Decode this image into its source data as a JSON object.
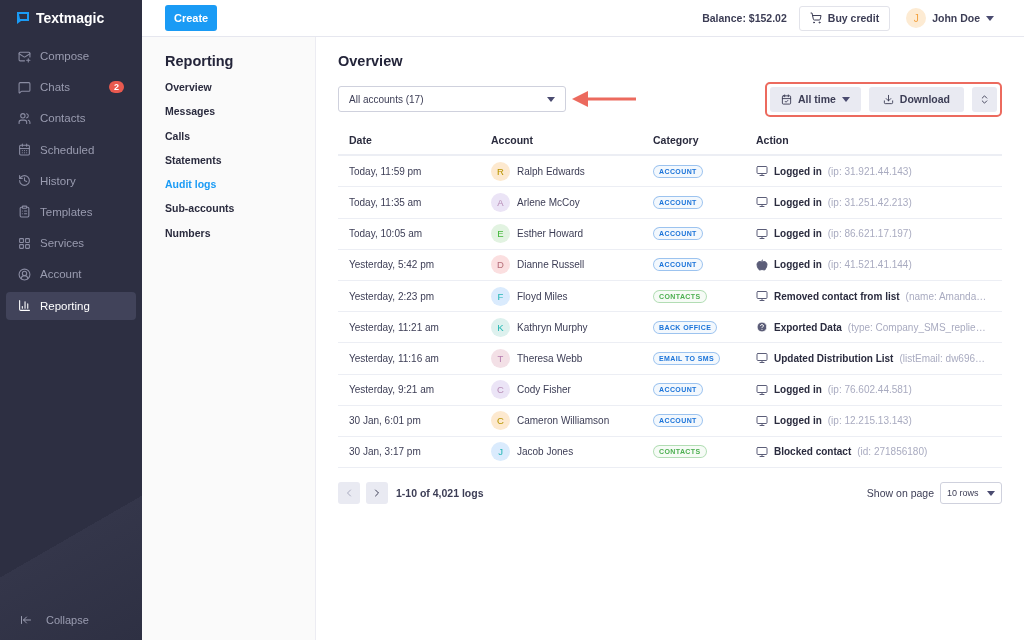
{
  "brand": "Textmagic",
  "sidebar": {
    "items": [
      {
        "label": "Compose",
        "selected": false
      },
      {
        "label": "Chats",
        "selected": false,
        "badge": "2"
      },
      {
        "label": "Contacts",
        "selected": false
      },
      {
        "label": "Scheduled",
        "selected": false
      },
      {
        "label": "History",
        "selected": false
      },
      {
        "label": "Templates",
        "selected": false
      },
      {
        "label": "Services",
        "selected": false
      },
      {
        "label": "Account",
        "selected": false
      },
      {
        "label": "Reporting",
        "selected": true
      }
    ],
    "collapse": "Collapse"
  },
  "topbar": {
    "create": "Create",
    "balance": "Balance: $152.02",
    "buy_credit": "Buy credit",
    "user_initial": "J",
    "user_name": "John Doe"
  },
  "subnav": {
    "title": "Reporting",
    "items": [
      {
        "label": "Overview",
        "selected": false
      },
      {
        "label": "Messages",
        "selected": false
      },
      {
        "label": "Calls",
        "selected": false
      },
      {
        "label": "Statements",
        "selected": false
      },
      {
        "label": "Audit logs",
        "selected": true
      },
      {
        "label": "Sub-accounts",
        "selected": false
      },
      {
        "label": "Numbers",
        "selected": false
      }
    ]
  },
  "page": {
    "title": "Overview",
    "account_filter": "All accounts (17)",
    "period": "All time",
    "download": "Download"
  },
  "table": {
    "columns": [
      "Date",
      "Account",
      "Category",
      "Action"
    ],
    "rows": [
      {
        "date": "Today, 11:59 pm",
        "avatar": {
          "initial": "R",
          "color": "#fde9cf"
        },
        "name": "Ralph Edwards",
        "category": {
          "label": "ACCOUNT",
          "color": "#1a73d9"
        },
        "kind": "monitor",
        "action": "Logged in",
        "detail": "(ip: 31.921.44.143)"
      },
      {
        "date": "Today, 11:35 am",
        "avatar": {
          "initial": "A",
          "color": "#ebe4f6"
        },
        "name": "Arlene McCoy",
        "category": {
          "label": "ACCOUNT",
          "color": "#1a73d9"
        },
        "kind": "monitor",
        "action": "Logged in",
        "detail": "(ip: 31.251.42.213)"
      },
      {
        "date": "Today, 10:05 am",
        "avatar": {
          "initial": "E",
          "color": "#e2f3e1"
        },
        "name": "Esther Howard",
        "category": {
          "label": "ACCOUNT",
          "color": "#1a73d9"
        },
        "kind": "monitor",
        "action": "Logged in",
        "detail": "(ip: 86.621.17.197)"
      },
      {
        "date": "Yesterday, 5:42 pm",
        "avatar": {
          "initial": "D",
          "color": "#fbdfe0"
        },
        "name": "Dianne Russell",
        "category": {
          "label": "ACCOUNT",
          "color": "#1a73d9"
        },
        "kind": "apple",
        "action": "Logged in",
        "detail": "(ip: 41.521.41.144)"
      },
      {
        "date": "Yesterday, 2:23 pm",
        "avatar": {
          "initial": "F",
          "color": "#daebfd"
        },
        "name": "Floyd Miles",
        "category": {
          "label": "CONTACTS",
          "color": "#4caf50"
        },
        "kind": "monitor",
        "action": "Removed contact from list",
        "detail": "(name: Amanda…"
      },
      {
        "date": "Yesterday, 11:21 am",
        "avatar": {
          "initial": "K",
          "color": "#ddf1ee"
        },
        "name": "Kathryn Murphy",
        "category": {
          "label": "BACK OFFICE",
          "color": "#1a73d9"
        },
        "kind": "question",
        "action": "Exported Data",
        "detail": "(type: Company_SMS_replie…"
      },
      {
        "date": "Yesterday, 11:16 am",
        "avatar": {
          "initial": "T",
          "color": "#f3e0e6"
        },
        "name": "Theresa Webb",
        "category": {
          "label": "EMAIL TO SMS",
          "color": "#1a73d9"
        },
        "kind": "monitor",
        "action": "Updated Distribution List",
        "detail": "(listEmail: dw696…"
      },
      {
        "date": "Yesterday, 9:21 am",
        "avatar": {
          "initial": "C",
          "color": "#ebe4f6"
        },
        "name": "Cody Fisher",
        "category": {
          "label": "ACCOUNT",
          "color": "#1a73d9"
        },
        "kind": "monitor",
        "action": "Logged in",
        "detail": "(ip: 76.602.44.581)"
      },
      {
        "date": "30 Jan, 6:01 pm",
        "avatar": {
          "initial": "C",
          "color": "#fde9cf"
        },
        "name": "Cameron Williamson",
        "category": {
          "label": "ACCOUNT",
          "color": "#1a73d9"
        },
        "kind": "monitor",
        "action": "Logged in",
        "detail": "(ip: 12.215.13.143)"
      },
      {
        "date": "30 Jan, 3:17 pm",
        "avatar": {
          "initial": "J",
          "color": "#daebfd"
        },
        "name": "Jacob Jones",
        "category": {
          "label": "CONTACTS",
          "color": "#4caf50"
        },
        "kind": "monitor",
        "action": "Blocked contact",
        "detail": "(id: 271856180)"
      }
    ]
  },
  "pagination": {
    "range": "1-10 of 4,021 logs",
    "show_label": "Show on page",
    "rows_value": "10 rows"
  }
}
